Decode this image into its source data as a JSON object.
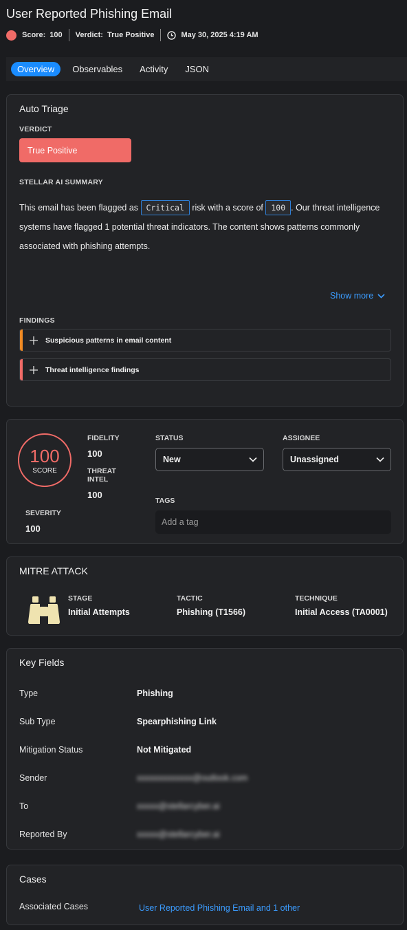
{
  "header": {
    "title": "User Reported Phishing Email",
    "score_label": "Score:",
    "score_value": "100",
    "verdict_label": "Verdict:",
    "verdict_value": "True Positive",
    "timestamp": "May 30, 2025 4:19 AM"
  },
  "tabs": [
    {
      "label": "Overview",
      "active": true
    },
    {
      "label": "Observables",
      "active": false
    },
    {
      "label": "Activity",
      "active": false
    },
    {
      "label": "JSON",
      "active": false
    }
  ],
  "auto_triage": {
    "title": "Auto Triage",
    "verdict_label": "VERDICT",
    "verdict_value": "True Positive",
    "summary_label": "STELLAR AI SUMMARY",
    "summary_part1": "This email has been flagged as ",
    "summary_chip1": "Critical",
    "summary_part2": " risk with a score of ",
    "summary_chip2": "100",
    "summary_part3": ". Our threat intelligence systems have flagged 1 potential threat indicators. The content shows patterns commonly associated with phishing attempts.",
    "show_more": "Show more",
    "findings_label": "FINDINGS",
    "findings": [
      {
        "label": "Suspicious patterns in email content",
        "color": "#f08a24"
      },
      {
        "label": "Threat intelligence findings",
        "color": "#f06b67"
      }
    ]
  },
  "scores": {
    "score_value": "100",
    "score_caption": "SCORE",
    "fidelity_label": "FIDELITY",
    "fidelity_value": "100",
    "threat_intel_label_1": "THREAT",
    "threat_intel_label_2": "INTEL",
    "threat_intel_value": "100",
    "severity_label": "SEVERITY",
    "severity_value": "100",
    "status_label": "STATUS",
    "status_value": "New",
    "assignee_label": "ASSIGNEE",
    "assignee_value": "Unassigned",
    "tags_label": "TAGS",
    "tags_placeholder": "Add a tag"
  },
  "mitre": {
    "title": "MITRE ATTACK",
    "icon": "binoculars-icon",
    "stage_label": "STAGE",
    "stage_value": "Initial Attempts",
    "tactic_label": "TACTIC",
    "tactic_value": "Phishing (T1566)",
    "technique_label": "TECHNIQUE",
    "technique_value": "Initial Access (TA0001)"
  },
  "key_fields": {
    "title": "Key Fields",
    "rows": [
      {
        "key": "Type",
        "value": "Phishing"
      },
      {
        "key": "Sub Type",
        "value": "Spearphishing Link"
      },
      {
        "key": "Mitigation Status",
        "value": "Not Mitigated"
      },
      {
        "key": "Sender",
        "value": "xxxxxxxxxxxxx@outlook.com"
      },
      {
        "key": "To",
        "value": "xxxxx@stellarcyber.ai"
      },
      {
        "key": "Reported By",
        "value": "xxxxx@stellarcyber.ai"
      }
    ]
  },
  "cases": {
    "title": "Cases",
    "associated_label": "Associated Cases",
    "associated_link": "User Reported Phishing Email and 1 other"
  },
  "colors": {
    "accent": "#1a8cff",
    "critical": "#f06b67",
    "warning": "#f08a24",
    "link": "#3b9cff"
  }
}
